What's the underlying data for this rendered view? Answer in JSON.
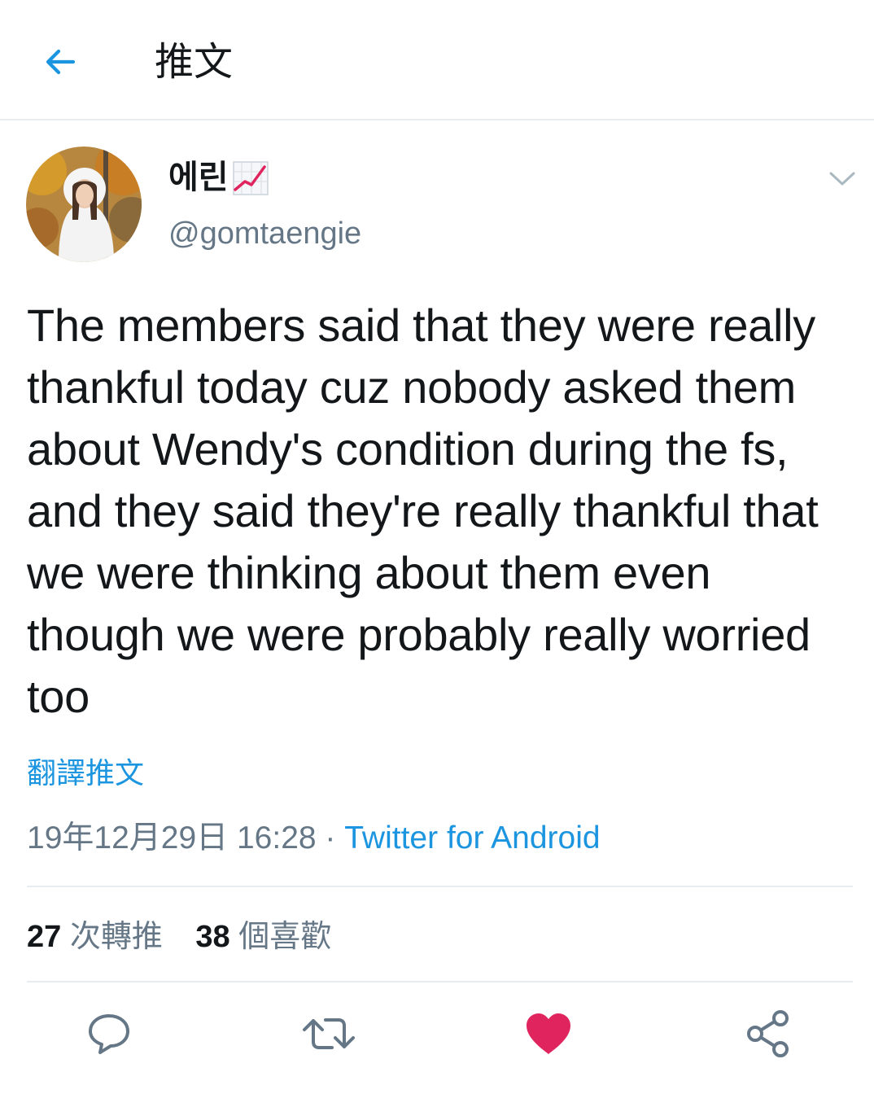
{
  "header": {
    "title": "推文",
    "back_icon": "arrow-left-icon"
  },
  "colors": {
    "accent": "#1b95e0",
    "secondary_text": "#657786",
    "primary_text": "#14171a",
    "like": "#e0245e",
    "divider": "#e6ecf0"
  },
  "author": {
    "display_name": "에린",
    "name_emoji": "chart-increasing-emoji",
    "handle": "@gomtaengie"
  },
  "tweet": {
    "text": "The members said that they were really thankful today cuz nobody asked them about Wendy's condition during the fs, and they said they're really thankful that we were thinking about them even though we were probably really worried too",
    "translate_label": "翻譯推文",
    "timestamp": "19年12月29日 16:28",
    "separator": "·",
    "source": "Twitter for Android"
  },
  "stats": {
    "retweets_count": "27",
    "retweets_label": "次轉推",
    "likes_count": "38",
    "likes_label": "個喜歡"
  },
  "actions": [
    {
      "icon": "reply-icon"
    },
    {
      "icon": "retweet-icon"
    },
    {
      "icon": "heart-icon",
      "active": true
    },
    {
      "icon": "share-icon"
    }
  ]
}
